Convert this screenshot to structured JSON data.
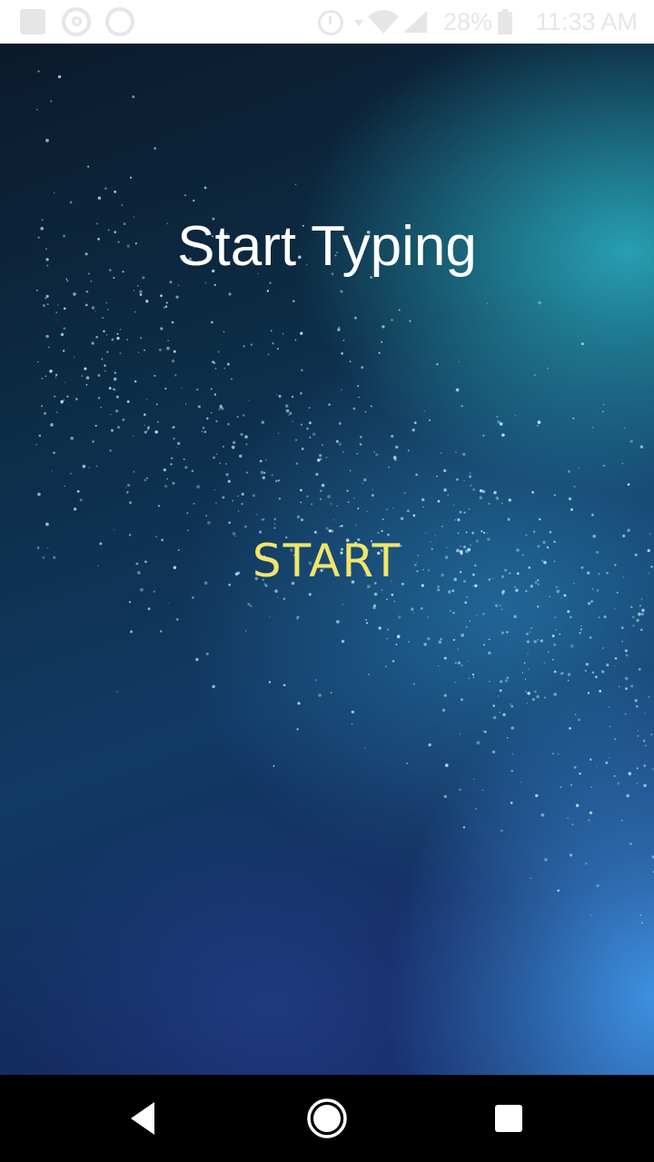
{
  "status_bar": {
    "battery": "28%",
    "time": "11:33 AM",
    "icons": [
      "notification-square-icon",
      "whatsapp-icon",
      "circle-notification-icon",
      "alarm-icon",
      "data-arrow-icon",
      "wifi-icon",
      "signal-icon",
      "battery-icon"
    ]
  },
  "screen": {
    "title": "Start Typing",
    "start_label": "START"
  },
  "nav_bar": {
    "icons": [
      "back-icon",
      "home-icon",
      "recents-icon"
    ]
  },
  "colors": {
    "title": "#ffffff",
    "start": "#f2e56a",
    "status_bar_bg": "#ffffff",
    "status_bar_fg": "#e6e6e6",
    "nav_bar_bg": "#000000"
  }
}
